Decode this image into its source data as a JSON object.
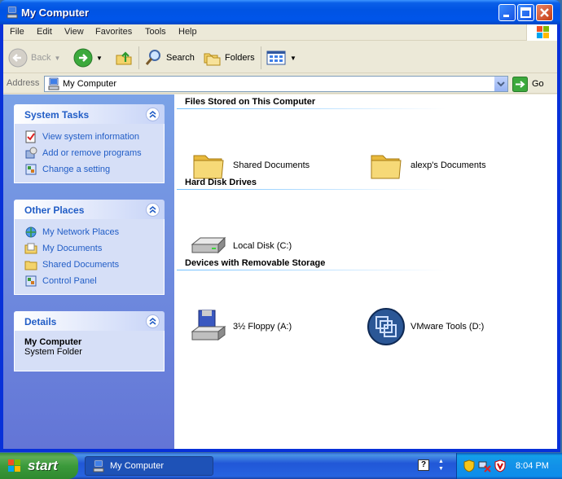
{
  "window": {
    "title": "My Computer"
  },
  "menu": [
    "File",
    "Edit",
    "View",
    "Favorites",
    "Tools",
    "Help"
  ],
  "toolbar": {
    "back": "Back",
    "search": "Search",
    "folders": "Folders"
  },
  "address": {
    "label": "Address",
    "value": "My Computer",
    "go": "Go"
  },
  "panels": {
    "system_tasks": {
      "title": "System Tasks",
      "items": [
        {
          "label": "View system information",
          "icon": "system-info-icon"
        },
        {
          "label": "Add or remove programs",
          "icon": "add-remove-programs-icon"
        },
        {
          "label": "Change a setting",
          "icon": "control-panel-icon"
        }
      ]
    },
    "other_places": {
      "title": "Other Places",
      "items": [
        {
          "label": "My Network Places",
          "icon": "network-places-icon"
        },
        {
          "label": "My Documents",
          "icon": "my-documents-icon"
        },
        {
          "label": "Shared Documents",
          "icon": "shared-folder-icon"
        },
        {
          "label": "Control Panel",
          "icon": "control-panel-icon"
        }
      ]
    },
    "details": {
      "title": "Details",
      "name": "My Computer",
      "type": "System Folder"
    }
  },
  "groups": [
    {
      "title": "Files Stored on This Computer",
      "items": [
        {
          "label": "Shared Documents",
          "icon": "folder-icon"
        },
        {
          "label": "alexp's Documents",
          "icon": "folder-icon"
        }
      ]
    },
    {
      "title": "Hard Disk Drives",
      "items": [
        {
          "label": "Local Disk (C:)",
          "icon": "hard-disk-icon"
        }
      ]
    },
    {
      "title": "Devices with Removable Storage",
      "items": [
        {
          "label": "3½ Floppy (A:)",
          "icon": "floppy-drive-icon"
        },
        {
          "label": "VMware Tools (D:)",
          "icon": "vmware-cd-icon"
        }
      ]
    }
  ],
  "taskbar": {
    "start": "start",
    "task": "My Computer",
    "clock": "8:04 PM"
  },
  "colors": {
    "title_blue": "#0054e3",
    "link_blue": "#215dc6",
    "start_green": "#3b9a3b"
  }
}
